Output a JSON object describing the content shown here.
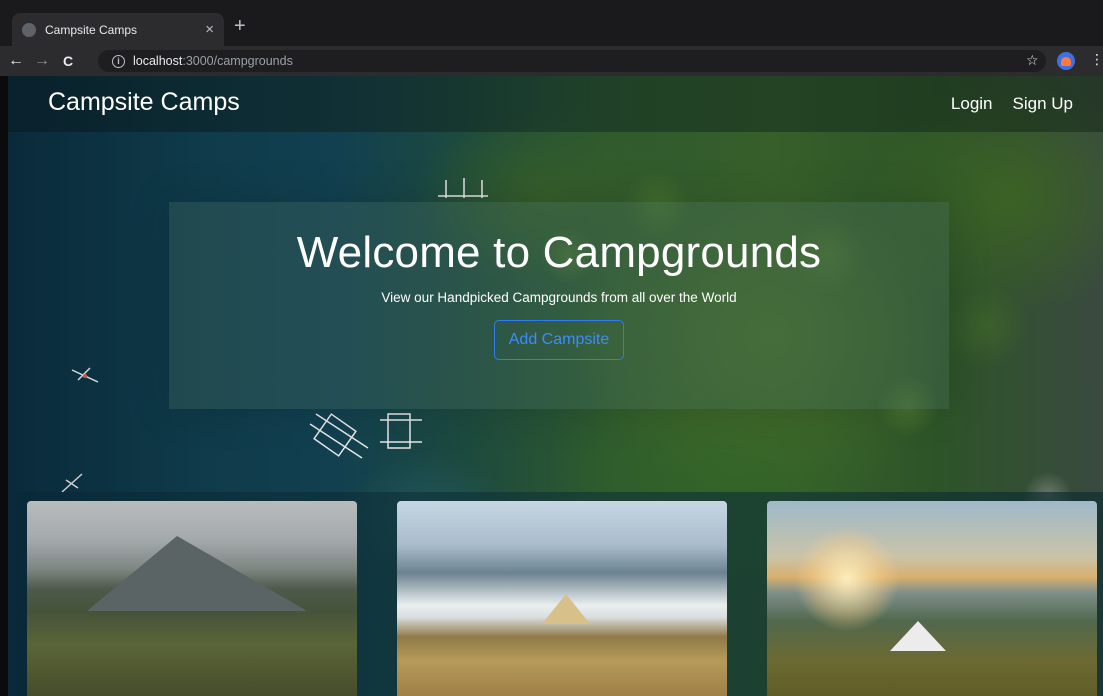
{
  "browser": {
    "tab_title": "Campsite Camps",
    "tab_close": "×",
    "new_tab": "+",
    "url_host": "localhost",
    "url_path": ":3000/campgrounds"
  },
  "navbar": {
    "brand": "Campsite Camps",
    "links": [
      "Login",
      "Sign Up"
    ]
  },
  "hero": {
    "title": "Welcome to Campgrounds",
    "subtitle": "View our Handpicked Campgrounds from all over the World",
    "button": "Add Campsite"
  },
  "colors": {
    "button_outline": "#2f7df6",
    "text": "#ffffff"
  }
}
